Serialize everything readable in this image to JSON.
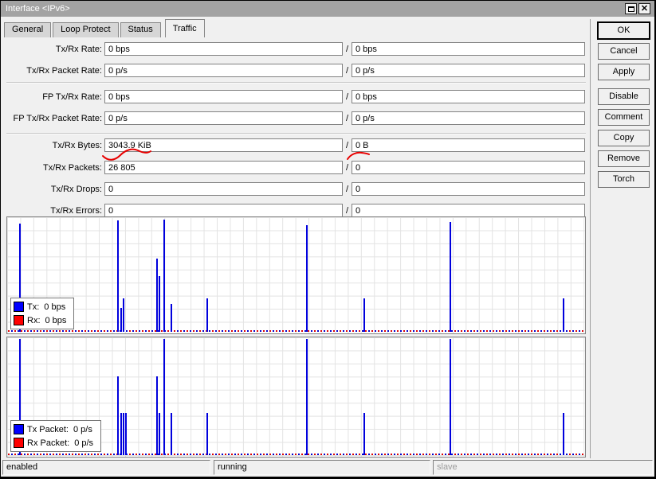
{
  "window": {
    "title": "Interface <IPv6>"
  },
  "tabs": [
    {
      "label": "General",
      "active": false
    },
    {
      "label": "Loop Protect",
      "active": false
    },
    {
      "label": "Status",
      "active": false
    },
    {
      "label": "Traffic",
      "active": true
    }
  ],
  "form": {
    "slash": "/",
    "rows": [
      {
        "label": "Tx/Rx Rate:",
        "tx": "0 bps",
        "rx": "0 bps"
      },
      {
        "label": "Tx/Rx Packet Rate:",
        "tx": "0 p/s",
        "rx": "0 p/s"
      },
      {
        "label": "FP Tx/Rx Rate:",
        "tx": "0 bps",
        "rx": "0 bps"
      },
      {
        "label": "FP Tx/Rx Packet Rate:",
        "tx": "0 p/s",
        "rx": "0 p/s"
      },
      {
        "label": "Tx/Rx Bytes:",
        "tx": "3043.9 KiB",
        "rx": "0 B"
      },
      {
        "label": "Tx/Rx Packets:",
        "tx": "26 805",
        "rx": "0"
      },
      {
        "label": "Tx/Rx Drops:",
        "tx": "0",
        "rx": "0"
      },
      {
        "label": "Tx/Rx Errors:",
        "tx": "0",
        "rx": "0"
      }
    ]
  },
  "buttons": [
    "OK",
    "Cancel",
    "Apply",
    "Disable",
    "Comment",
    "Copy",
    "Remove",
    "Torch"
  ],
  "charts": [
    {
      "name": "traffic-rate-graph",
      "legend": [
        {
          "name": "Tx:",
          "value": "0 bps",
          "color": "#0000ff"
        },
        {
          "name": "Rx:",
          "value": "0 bps",
          "color": "#ff0000"
        }
      ],
      "spikes": [
        [
          15,
          136
        ],
        [
          138,
          140
        ],
        [
          142,
          30
        ],
        [
          145,
          42
        ],
        [
          187,
          92
        ],
        [
          190,
          70
        ],
        [
          196,
          141
        ],
        [
          205,
          35
        ],
        [
          250,
          42
        ],
        [
          375,
          134
        ],
        [
          447,
          42
        ],
        [
          555,
          138
        ],
        [
          697,
          42
        ]
      ]
    },
    {
      "name": "packet-rate-graph",
      "legend": [
        {
          "name": "Tx Packet:",
          "value": "0 p/s",
          "color": "#0000ff"
        },
        {
          "name": "Rx Packet:",
          "value": "0 p/s",
          "color": "#ff0000"
        }
      ],
      "spikes": [
        [
          15,
          146
        ],
        [
          138,
          99
        ],
        [
          142,
          53
        ],
        [
          145,
          53
        ],
        [
          148,
          53
        ],
        [
          187,
          99
        ],
        [
          190,
          53
        ],
        [
          196,
          146
        ],
        [
          205,
          53
        ],
        [
          250,
          53
        ],
        [
          375,
          146
        ],
        [
          447,
          53
        ],
        [
          555,
          146
        ],
        [
          697,
          53
        ]
      ]
    }
  ],
  "status": [
    {
      "label": "enabled"
    },
    {
      "label": "running"
    },
    {
      "label": "slave"
    }
  ],
  "colors": {
    "tx": "#0000ff",
    "rx": "#ff0000",
    "spike": "#0000dd",
    "annotation": "#e80000",
    "titlebar": "#a3a3a3"
  }
}
